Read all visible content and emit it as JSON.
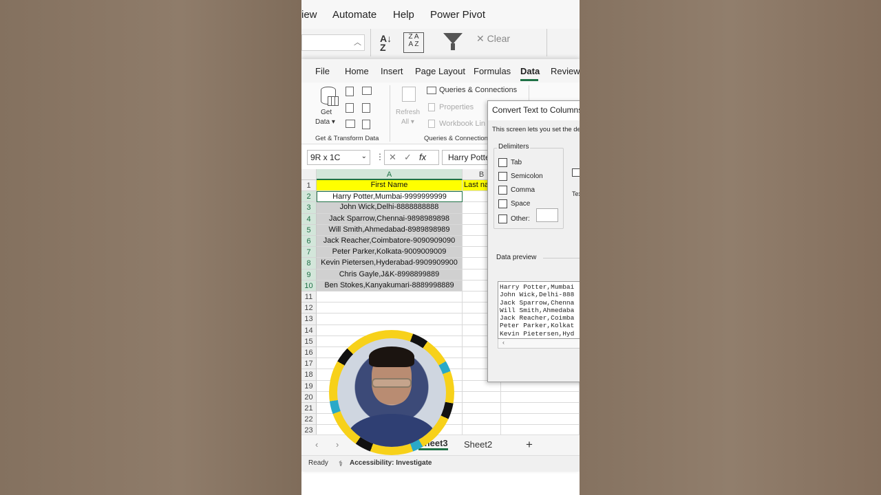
{
  "top_menu": {
    "items": [
      "iew",
      "Automate",
      "Help",
      "Power Pivot"
    ]
  },
  "top_ribbon": {
    "clear_label": "Clear"
  },
  "menubar": {
    "items": [
      "File",
      "Home",
      "Insert",
      "Page Layout",
      "Formulas",
      "Data",
      "Review"
    ],
    "active": "Data"
  },
  "ribbon": {
    "get_data": "Get",
    "get_data2": "Data",
    "refresh": "Refresh",
    "refresh_all": "All",
    "queries": "Queries & Connections",
    "properties": "Properties",
    "workbook_links": "Workbook Lin",
    "group_get_transform": "Get & Transform Data",
    "group_queries": "Queries & Connection"
  },
  "formula_bar": {
    "name_box": "9R x 1C",
    "fx": "fx",
    "value": "Harry Potte"
  },
  "sheet": {
    "columns": [
      "A",
      "B"
    ],
    "header_a": "First Name",
    "header_b": "Last na",
    "rows": [
      "Harry Potter,Mumbai-9999999999",
      "John Wick,Delhi-8888888888",
      "Jack Sparrow,Chennai-9898989898",
      "Will Smith,Ahmedabad-8989898989",
      "Jack Reacher,Coimbatore-9090909090",
      "Peter Parker,Kolkata-9009009009",
      "Kevin Pietersen,Hyderabad-9909909900",
      "Chris Gayle,J&K-8998899889",
      "Ben Stokes,Kanyakumari-8889998889"
    ],
    "row_numbers": [
      "1",
      "2",
      "3",
      "4",
      "5",
      "6",
      "7",
      "8",
      "9",
      "10",
      "11",
      "12",
      "13",
      "14",
      "15",
      "16",
      "17",
      "18",
      "19",
      "20",
      "21",
      "22",
      "23"
    ]
  },
  "tabs": {
    "sheet3": "Sheet3",
    "sheet2": "Sheet2",
    "add": "+"
  },
  "status": {
    "ready": "Ready",
    "accessibility": "Accessibility: Investigate"
  },
  "dialog": {
    "title": "Convert Text to Columns W",
    "desc": "This screen lets you set the de",
    "delimiters_title": "Delimiters",
    "tab": "Tab",
    "semicolon": "Semicolon",
    "comma": "Comma",
    "space": "Space",
    "other": "Other:",
    "side_text": "Tex",
    "preview_title": "Data preview",
    "preview_lines": [
      "Harry Potter,Mumbai",
      "John Wick,Delhi-888",
      "Jack Sparrow,Chenna",
      "Will Smith,Ahmedaba",
      "Jack Reacher,Coimba",
      "Peter Parker,Kolkat",
      "Kevin Pietersen,Hyd"
    ]
  },
  "colors": {
    "accent": "#1e7145",
    "header_fill": "#ffff00",
    "selection": "#d0d0d0"
  }
}
